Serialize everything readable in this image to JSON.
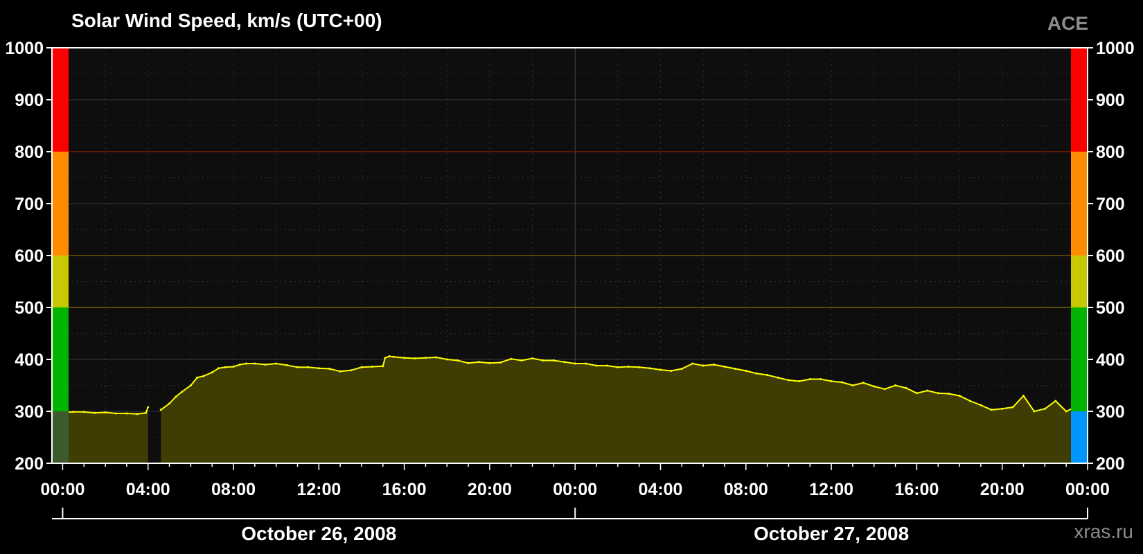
{
  "header": {
    "title": "Solar Wind Speed, km/s (UTC+00)",
    "source": "ACE",
    "site": "xras.ru"
  },
  "colors": {
    "background": "#000000",
    "plot_background": "#0e0e0e",
    "line": "#ffff00",
    "fill": "#3f3d04",
    "scale_blue": "#0096ff",
    "scale_green": "#00b400",
    "scale_yellow": "#c8c800",
    "scale_orange": "#ff8c00",
    "scale_red": "#ff0000"
  },
  "chart_data": {
    "type": "area",
    "title": "Solar Wind Speed, km/s (UTC+00)",
    "xlabel": "",
    "ylabel": "",
    "ylim": [
      200,
      1000
    ],
    "xlim_hours": [
      -0.5,
      48
    ],
    "yticks": [
      200,
      300,
      400,
      500,
      600,
      700,
      800,
      900,
      1000
    ],
    "xtick_hours": [
      0,
      4,
      8,
      12,
      16,
      20,
      24,
      28,
      32,
      36,
      40,
      44,
      48
    ],
    "xtick_labels": [
      "00:00",
      "04:00",
      "08:00",
      "12:00",
      "16:00",
      "20:00",
      "00:00",
      "04:00",
      "08:00",
      "12:00",
      "16:00",
      "20:00",
      "00:00"
    ],
    "date_labels": [
      {
        "label": "October 26, 2008",
        "center_hour": 12
      },
      {
        "label": "October 27, 2008",
        "center_hour": 36
      }
    ],
    "day_boundaries_hours": [
      0,
      24,
      48
    ],
    "threshold_lines": [
      {
        "value": 500,
        "color": "#6e6400"
      },
      {
        "value": 600,
        "color": "#6e5000"
      },
      {
        "value": 800,
        "color": "#7a1e00"
      }
    ],
    "speed_scale": [
      {
        "from": 200,
        "to": 300,
        "color": "#0096ff"
      },
      {
        "from": 300,
        "to": 500,
        "color": "#00b400"
      },
      {
        "from": 500,
        "to": 600,
        "color": "#c8c800"
      },
      {
        "from": 600,
        "to": 800,
        "color": "#ff8c00"
      },
      {
        "from": 800,
        "to": 1000,
        "color": "#ff0000"
      }
    ],
    "grid": true,
    "series": [
      {
        "hours": [
          -0.5,
          0,
          0.5,
          1,
          1.5,
          2,
          2.5,
          3,
          3.5,
          3.9,
          4.0,
          4.6,
          5.0,
          5.3,
          5.6,
          6.0,
          6.3,
          6.6,
          7.0,
          7.3,
          7.6,
          8.0,
          8.3,
          8.6,
          9.0,
          9.5,
          10.0,
          10.5,
          11.0,
          11.5,
          12.0,
          12.5,
          13.0,
          13.5,
          14.0,
          14.5,
          15.0,
          15.1,
          15.3,
          15.5,
          16.0,
          16.5,
          17.0,
          17.5,
          18.0,
          18.5,
          19.0,
          19.5,
          20.0,
          20.5,
          21.0,
          21.5,
          22.0,
          22.5,
          23.0,
          23.5,
          24.0,
          24.5,
          25.0,
          25.5,
          26.0,
          26.5,
          27.0,
          27.5,
          28.0,
          28.5,
          29.0,
          29.5,
          30.0,
          30.5,
          31.0,
          31.5,
          32.0,
          32.5,
          33.0,
          33.5,
          34.0,
          34.5,
          35.0,
          35.5,
          36.0,
          36.5,
          37.0,
          37.5,
          38.0,
          38.5,
          39.0,
          39.5,
          40.0,
          40.5,
          41.0,
          41.5,
          42.0,
          42.5,
          43.0,
          43.5,
          44.0,
          44.5,
          45.0,
          45.5,
          46.0,
          46.5,
          47.0,
          47.5,
          48.0
        ],
        "values": [
          297,
          298,
          299,
          299,
          297,
          298,
          296,
          296,
          295,
          297,
          308,
          303,
          315,
          328,
          338,
          350,
          365,
          368,
          375,
          383,
          385,
          386,
          390,
          392,
          392,
          390,
          392,
          389,
          385,
          385,
          383,
          382,
          377,
          379,
          385,
          386,
          387,
          403,
          406,
          405,
          403,
          402,
          403,
          404,
          400,
          398,
          393,
          395,
          393,
          394,
          401,
          398,
          402,
          398,
          398,
          395,
          392,
          392,
          388,
          388,
          385,
          386,
          385,
          383,
          380,
          378,
          382,
          392,
          388,
          390,
          386,
          382,
          378,
          373,
          370,
          365,
          360,
          358,
          362,
          362,
          358,
          356,
          350,
          355,
          348,
          343,
          350,
          345,
          335,
          340,
          335,
          334,
          330,
          320,
          312,
          303,
          305,
          308,
          330,
          300,
          305,
          320,
          300,
          310,
          300
        ]
      }
    ],
    "gaps_hours": [
      [
        4.1,
        4.6
      ]
    ]
  }
}
